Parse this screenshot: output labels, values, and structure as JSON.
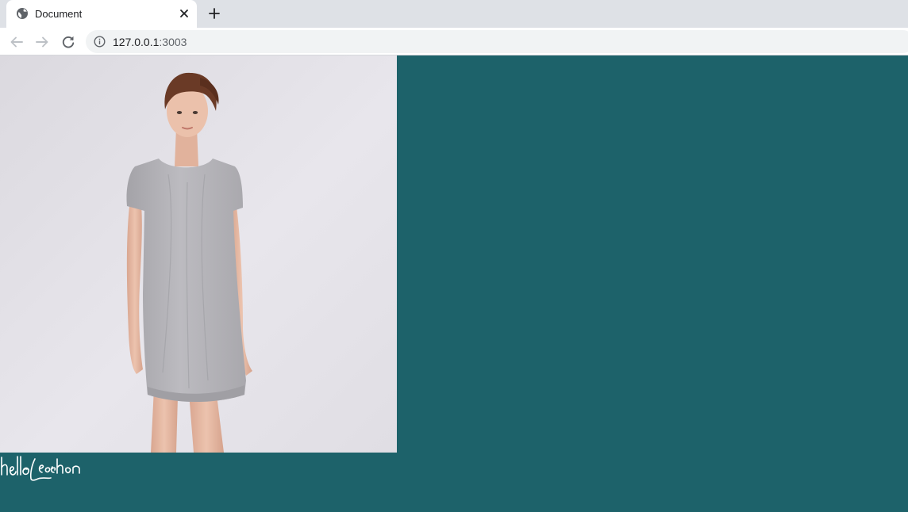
{
  "browser": {
    "tab": {
      "title": "Document",
      "favicon": "globe-icon",
      "close_icon": "close-icon"
    },
    "new_tab_icon": "plus-icon",
    "nav": {
      "back_icon": "arrow-left-icon",
      "forward_icon": "arrow-right-icon",
      "reload_icon": "reload-icon"
    },
    "address_bar": {
      "security_icon": "info-icon",
      "host": "127.0.0.1",
      "port": ":3003"
    }
  },
  "page": {
    "background_color": "#1d626a",
    "photo": {
      "subject": "woman-in-grey-dress",
      "backdrop_color": "#e4e2e8",
      "dress_color": "#b3b2b7"
    },
    "signature": {
      "text": "hello Leechen",
      "color": "#ffffff"
    }
  }
}
